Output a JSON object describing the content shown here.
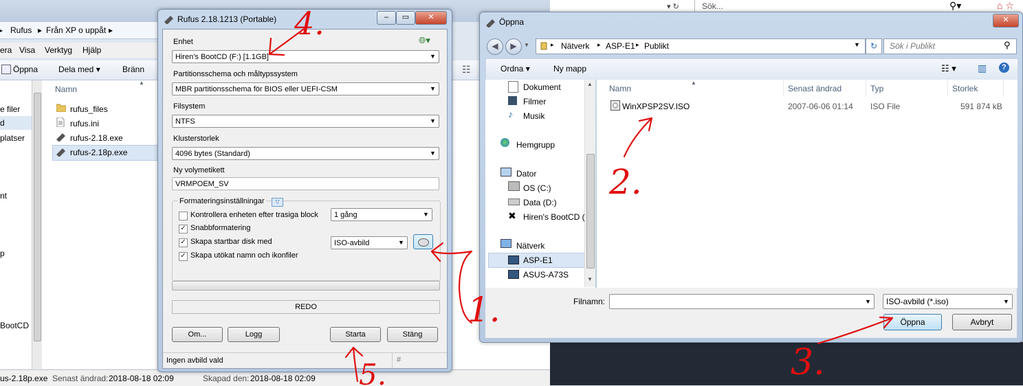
{
  "background_explorer": {
    "breadcrumb": [
      "Rufus",
      "Från XP o uppåt"
    ],
    "menu": [
      "era",
      "Visa",
      "Verktyg",
      "Hjälp"
    ],
    "toolbar": {
      "open": "Öppna",
      "share": "Dela med",
      "burn": "Bränn"
    },
    "nav_items": [
      "e filer",
      "d",
      "platser",
      "nt",
      "p",
      "BootCD ("
    ],
    "column_name": "Namn",
    "files": [
      "rufus_files",
      "rufus.ini",
      "rufus-2.18.exe",
      "rufus-2.18p.exe"
    ],
    "status": {
      "file": "us-2.18p.exe",
      "modified_label": "Senast ändrad:",
      "modified": "2018-08-18 02:09",
      "created_label": "Skapad den:",
      "created": "2018-08-18 02:09"
    },
    "right_search": "Sök..."
  },
  "rufus": {
    "title": "Rufus 2.18.1213 (Portable)",
    "device_label": "Enhet",
    "device_value": "Hiren's BootCD (F:) [1.1GB]",
    "partition_label": "Partitionsschema och måltypssystem",
    "partition_value": "MBR partitionsschema för BIOS eller UEFI-CSM",
    "fs_label": "Filsystem",
    "fs_value": "NTFS",
    "cluster_label": "Klusterstorlek",
    "cluster_value": "4096 bytes (Standard)",
    "volume_label": "Ny volymetikett",
    "volume_value": "VRMPOEM_SV",
    "format_group": "Formateringsinställningar",
    "opt_check_bad": "Kontrollera enheten efter trasiga block",
    "opt_check_bad_passes": "1 gång",
    "opt_quick": "Snabbformatering",
    "opt_bootable": "Skapa startbar disk med",
    "opt_bootable_type": "ISO-avbild",
    "opt_extended": "Skapa utökat namn och ikonfiler",
    "progress": 0,
    "status_text": "REDO",
    "btn_about": "Om...",
    "btn_log": "Logg",
    "btn_start": "Starta",
    "btn_close": "Stäng",
    "statusbar": "Ingen avbild vald",
    "statusbar_hash": "#"
  },
  "open_dialog": {
    "title": "Öppna",
    "path": [
      "Nätverk",
      "ASP-E1",
      "Publikt"
    ],
    "search_placeholder": "Sök i Publikt",
    "btn_organize": "Ordna",
    "btn_new_folder": "Ny mapp",
    "nav": {
      "libraries": [
        "Dokument",
        "Filmer",
        "Musik"
      ],
      "homegroup": "Hemgrupp",
      "computer": "Dator",
      "drives": [
        "OS (C:)",
        "Data (D:)",
        "Hiren's BootCD ("
      ],
      "network": "Nätverk",
      "hosts": [
        "ASP-E1",
        "ASUS-A73S"
      ]
    },
    "columns": {
      "name": "Namn",
      "modified": "Senast ändrad",
      "type": "Typ",
      "size": "Storlek"
    },
    "file": {
      "name": "WinXPSP2SV.ISO",
      "modified": "2007-06-06 01:14",
      "type": "ISO File",
      "size": "591 874 kB"
    },
    "filename_label": "Filnamn:",
    "filename_value": "",
    "filter_value": "ISO-avbild (*.iso)",
    "btn_open": "Öppna",
    "btn_cancel": "Avbryt"
  },
  "annotations": [
    "1.",
    "2.",
    "3.",
    "4.",
    "5."
  ],
  "colors": {
    "annotation_red": "#e01010",
    "selection_blue": "#cde8ff",
    "title_gradient": "#c9d9ec"
  }
}
